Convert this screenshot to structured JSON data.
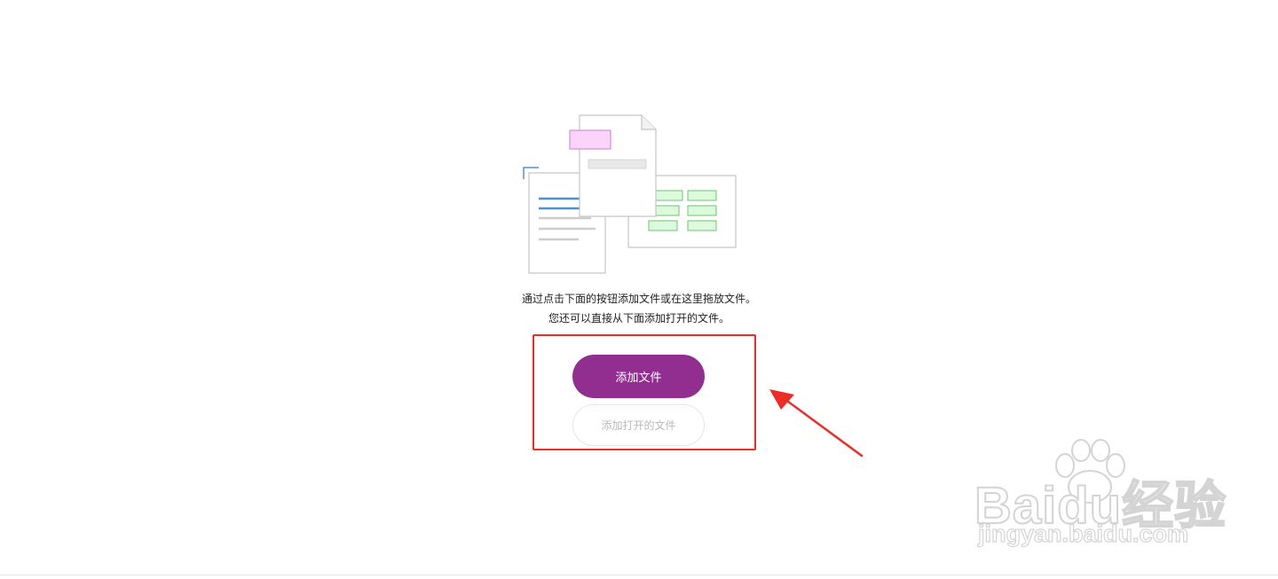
{
  "instructions": {
    "line1": "通过点击下面的按钮添加文件或在这里拖放文件。",
    "line2": "您还可以直接从下面添加打开的文件。"
  },
  "buttons": {
    "add_files": "添加文件",
    "add_open_files": "添加打开的文件"
  },
  "watermark": {
    "brand": "Baidu经验",
    "domain": "jingyan.baidu.com"
  },
  "colors": {
    "primary_button": "#922e90",
    "annotation_red": "#ee2b24"
  },
  "icons": {
    "illustration": "documents-illustration",
    "annotation": "red-arrow",
    "watermark_logo": "baidu-paw-logo"
  }
}
